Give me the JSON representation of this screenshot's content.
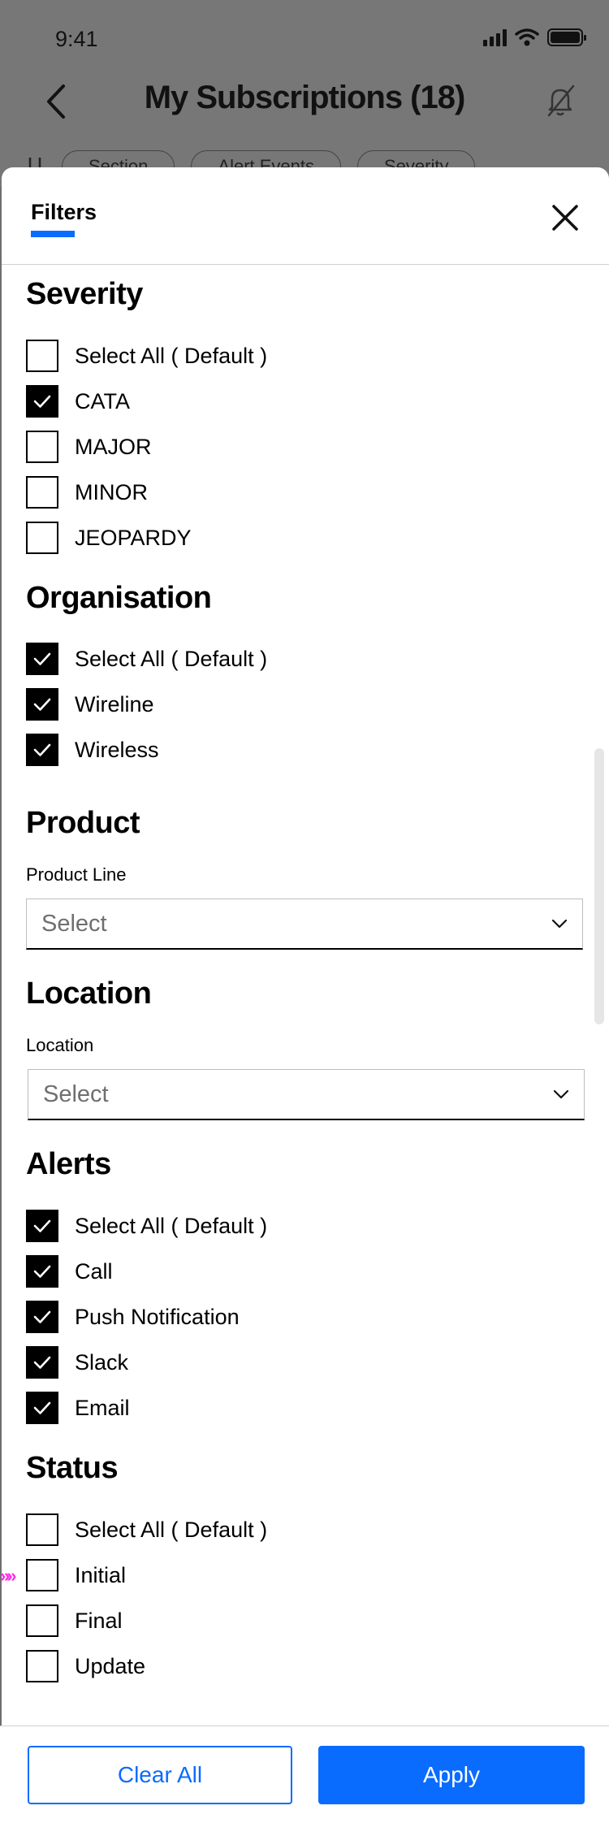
{
  "status_bar": {
    "time": "9:41"
  },
  "background": {
    "title": "My Subscriptions (18)",
    "chips": [
      "Section",
      "Alert Events",
      "Severity"
    ]
  },
  "sheet": {
    "tab_label": "Filters",
    "sections": {
      "severity": {
        "title": "Severity",
        "options": [
          {
            "label": "Select All ( Default )",
            "checked": false
          },
          {
            "label": "CATA",
            "checked": true
          },
          {
            "label": "MAJOR",
            "checked": false
          },
          {
            "label": "MINOR",
            "checked": false
          },
          {
            "label": "JEOPARDY",
            "checked": false
          }
        ]
      },
      "organisation": {
        "title": "Organisation",
        "options": [
          {
            "label": "Select All ( Default )",
            "checked": true
          },
          {
            "label": "Wireline",
            "checked": true
          },
          {
            "label": "Wireless",
            "checked": true
          }
        ]
      },
      "product": {
        "title": "Product",
        "field_label": "Product Line",
        "placeholder": "Select"
      },
      "location": {
        "title": "Location",
        "field_label": "Location",
        "placeholder": "Select"
      },
      "alerts": {
        "title": "Alerts",
        "options": [
          {
            "label": "Select All ( Default )",
            "checked": true
          },
          {
            "label": "Call",
            "checked": true
          },
          {
            "label": "Push Notification",
            "checked": true
          },
          {
            "label": "Slack",
            "checked": true
          },
          {
            "label": "Email",
            "checked": true
          }
        ]
      },
      "status": {
        "title": "Status",
        "options": [
          {
            "label": "Select All ( Default )",
            "checked": false
          },
          {
            "label": "Initial",
            "checked": false
          },
          {
            "label": "Final",
            "checked": false
          },
          {
            "label": "Update",
            "checked": false
          }
        ]
      }
    },
    "marker": "»»",
    "footer": {
      "clear_label": "Clear All",
      "apply_label": "Apply"
    }
  },
  "colors": {
    "accent": "#0a6cff",
    "marker": "#ff2de0"
  }
}
